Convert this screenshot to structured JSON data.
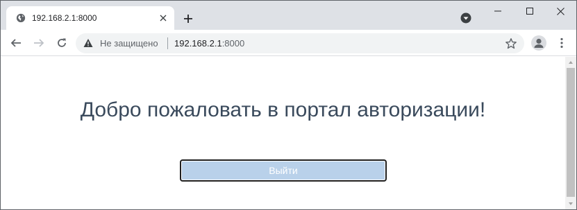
{
  "tab": {
    "title": "192.168.2.1:8000",
    "favicon": "globe-icon"
  },
  "window_controls": [
    "minimize-icon",
    "maximize-icon",
    "close-icon"
  ],
  "toolbar": {
    "security_label": "Не защищено",
    "url_host": "192.168.2.1",
    "url_port": ":8000"
  },
  "page": {
    "welcome_title": "Добро пожаловать в портал авторизации!",
    "logout_label": "Выйти"
  },
  "colors": {
    "tabstrip_bg": "#dee1e6",
    "omnibox_bg": "#f1f3f4",
    "button_bg": "#b9d1ea",
    "title_text": "#3a4a5c"
  }
}
